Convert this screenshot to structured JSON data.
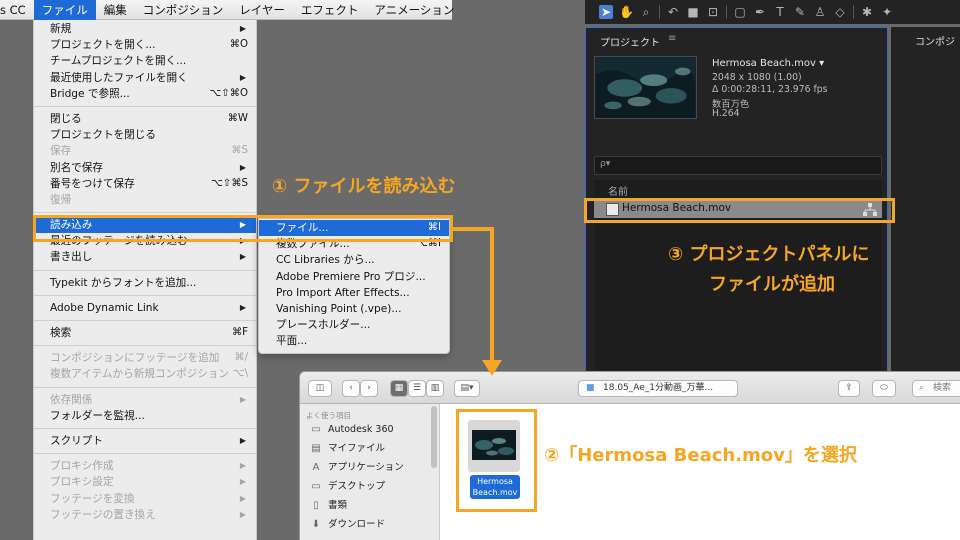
{
  "menubar": {
    "items": [
      "s CC",
      "ファイル",
      "編集",
      "コンポジション",
      "レイヤー",
      "エフェクト",
      "アニメーション"
    ],
    "active_index": 1
  },
  "file_menu": {
    "items": [
      {
        "label": "新規",
        "shortcut": "",
        "submenu": true,
        "disabled": false
      },
      {
        "label": "プロジェクトを開く...",
        "shortcut": "⌘O",
        "submenu": false,
        "disabled": false
      },
      {
        "label": "チームプロジェクトを開く...",
        "shortcut": "",
        "submenu": false,
        "disabled": false
      },
      {
        "label": "最近使用したファイルを開く",
        "shortcut": "",
        "submenu": true,
        "disabled": false
      },
      {
        "label": "Bridge で参照...",
        "shortcut": "⌥⇧⌘O",
        "submenu": false,
        "disabled": false
      },
      {
        "label": "閉じる",
        "shortcut": "⌘W",
        "submenu": false,
        "disabled": false
      },
      {
        "label": "プロジェクトを閉じる",
        "shortcut": "",
        "submenu": false,
        "disabled": false
      },
      {
        "label": "保存",
        "shortcut": "⌘S",
        "submenu": false,
        "disabled": true
      },
      {
        "label": "別名で保存",
        "shortcut": "",
        "submenu": true,
        "disabled": false
      },
      {
        "label": "番号をつけて保存",
        "shortcut": "⌥⇧⌘S",
        "submenu": false,
        "disabled": false
      },
      {
        "label": "復帰",
        "shortcut": "",
        "submenu": false,
        "disabled": true
      },
      {
        "label": "読み込み",
        "shortcut": "",
        "submenu": true,
        "disabled": false,
        "highlighted": true
      },
      {
        "label": "最近のフッテージを読み込む",
        "shortcut": "",
        "submenu": true,
        "disabled": false
      },
      {
        "label": "書き出し",
        "shortcut": "",
        "submenu": true,
        "disabled": false
      },
      {
        "label": "Typekit からフォントを追加...",
        "shortcut": "",
        "submenu": false,
        "disabled": false
      },
      {
        "label": "Adobe Dynamic Link",
        "shortcut": "",
        "submenu": true,
        "disabled": false
      },
      {
        "label": "検索",
        "shortcut": "⌘F",
        "submenu": false,
        "disabled": false
      },
      {
        "label": "コンポジションにフッテージを追加",
        "shortcut": "⌘/",
        "submenu": false,
        "disabled": true
      },
      {
        "label": "複数アイテムから新規コンポジション",
        "shortcut": "⌥\\",
        "submenu": false,
        "disabled": true
      },
      {
        "label": "依存関係",
        "shortcut": "",
        "submenu": true,
        "disabled": true
      },
      {
        "label": "フォルダーを監視...",
        "shortcut": "",
        "submenu": false,
        "disabled": false
      },
      {
        "label": "スクリプト",
        "shortcut": "",
        "submenu": true,
        "disabled": false
      },
      {
        "label": "プロキシ作成",
        "shortcut": "",
        "submenu": true,
        "disabled": true
      },
      {
        "label": "プロキシ設定",
        "shortcut": "",
        "submenu": true,
        "disabled": true
      },
      {
        "label": "フッテージを変換",
        "shortcut": "",
        "submenu": true,
        "disabled": true
      },
      {
        "label": "フッテージの置き換え",
        "shortcut": "",
        "submenu": true,
        "disabled": true
      }
    ]
  },
  "import_submenu": {
    "items": [
      {
        "label": "ファイル...",
        "shortcut": "⌘I",
        "highlighted": true
      },
      {
        "label": "複数ファイル...",
        "shortcut": "⌥⌘I",
        "highlighted": false
      },
      {
        "label": "CC Libraries から...",
        "shortcut": "",
        "highlighted": false
      },
      {
        "label": "Adobe Premiere Pro プロジ...",
        "shortcut": "",
        "highlighted": false
      },
      {
        "label": "Pro Import After Effects...",
        "shortcut": "",
        "highlighted": false
      },
      {
        "label": "Vanishing Point (.vpe)...",
        "shortcut": "",
        "highlighted": false
      },
      {
        "label": "プレースホルダー...",
        "shortcut": "",
        "highlighted": false
      },
      {
        "label": "平面...",
        "shortcut": "",
        "highlighted": false
      }
    ]
  },
  "callouts": {
    "step1": "① ファイルを読み込む",
    "step2": "②「Hermosa Beach.mov」を選択",
    "step3_line1": "③ プロジェクトパネルに",
    "step3_line2": "ファイルが追加"
  },
  "toolbar": {
    "icons": [
      "selection-tool",
      "hand-tool",
      "zoom-tool",
      "rotate-tool",
      "camera-tool",
      "pan-behind-tool",
      "rectangle-tool",
      "pen-tool",
      "type-tool",
      "brush-tool",
      "clone-stamp-tool",
      "eraser-tool",
      "roto-brush-tool",
      "puppet-tool"
    ]
  },
  "project_panel": {
    "title": "プロジェクト",
    "menu_icon": "≡",
    "file_name": "Hermosa Beach.mov ▾",
    "dimensions": "2048 x 1080 (1.00)",
    "duration": "Δ 0:00:28:11, 23.976 fps",
    "color": "数百万色",
    "codec": "H.264",
    "search_placeholder": "ρ▾",
    "column_name": "名前",
    "item_name": "Hermosa Beach.mov"
  },
  "comp_panel": {
    "title": "コンポジ"
  },
  "finder": {
    "path": "18.05_Ae_1分動画_万華...",
    "search_label": "検索",
    "sidebar_heading": "よく使う項目",
    "sidebar_items": [
      {
        "label": "Autodesk 360",
        "icon": "folder-icon"
      },
      {
        "label": "マイファイル",
        "icon": "my-files-icon"
      },
      {
        "label": "アプリケーション",
        "icon": "applications-icon"
      },
      {
        "label": "デスクトップ",
        "icon": "desktop-icon"
      },
      {
        "label": "書類",
        "icon": "documents-icon"
      },
      {
        "label": "ダウンロード",
        "icon": "downloads-icon"
      }
    ],
    "file_label_line1": "Hermosa",
    "file_label_line2": "Beach.mov"
  },
  "colors": {
    "accent_orange": "#f5a623",
    "selection_blue": "#1e6ad6",
    "ae_panel": "#232323",
    "background": "#6a6a6a"
  }
}
